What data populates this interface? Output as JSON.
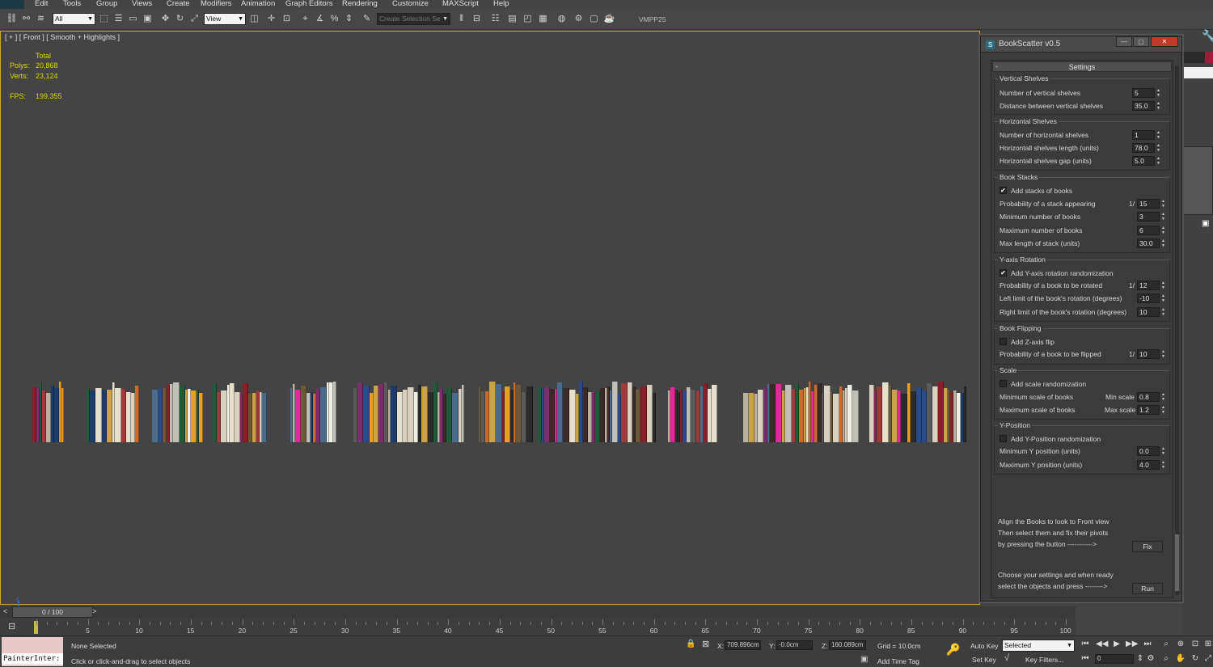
{
  "menu": [
    "Edit",
    "Tools",
    "Group",
    "Views",
    "Create",
    "Modifiers",
    "Animation",
    "Graph Editors",
    "Rendering",
    "Customize",
    "MAXScript",
    "Help"
  ],
  "toolbar": {
    "selection_filter": "All",
    "reference_coord": "View",
    "named_selection_placeholder": "Create Selection Se",
    "plugin_label": "VMPP25"
  },
  "viewport": {
    "label": "[ + ] [ Front ] [ Smooth + Highlights ]",
    "stats_header": "Total",
    "polys_label": "Polys:",
    "polys_value": "20,868",
    "verts_label": "Verts:",
    "verts_value": "23,124",
    "fps_label": "FPS:",
    "fps_value": "199.355"
  },
  "dialog": {
    "title": "BookScatter v0.5",
    "rollout_title": "Settings",
    "rollout_toggle": "-",
    "vertical": {
      "title": "Vertical Shelves",
      "num_label": "Number of vertical shelves",
      "num_value": "5",
      "dist_label": "Distance between vertical shelves",
      "dist_value": "35.0"
    },
    "horizontal": {
      "title": "Horizontal Shelves",
      "num_label": "Number of horizontal shelves",
      "num_value": "1",
      "len_label": "Horizontall shelves length (units)",
      "len_value": "78.0",
      "gap_label": "Horizontall shelves gap (units)",
      "gap_value": "5.0"
    },
    "stacks": {
      "title": "Book Stacks",
      "check_label": "Add stacks of books",
      "checked": true,
      "prob_label": "Probability of a stack appearing",
      "prob_prefix": "1/",
      "prob_value": "15",
      "min_label": "Minimum number of books",
      "min_value": "3",
      "max_label": "Maximum number of books",
      "max_value": "6",
      "len_label": "Max length of stack (units)",
      "len_value": "30.0"
    },
    "yrot": {
      "title": "Y-axis Rotation",
      "check_label": "Add Y-axis rotation randomization",
      "checked": true,
      "prob_label": "Probability of a book to be rotated",
      "prob_prefix": "1/",
      "prob_value": "12",
      "left_label": "Left limit of the book's rotation (degrees)",
      "left_value": "-10",
      "right_label": "Right limit of the book's rotation (degrees)",
      "right_value": "10"
    },
    "flip": {
      "title": "Book Flipping",
      "check_label": "Add Z-axis flip",
      "checked": false,
      "prob_label": "Probability of a book to be flipped",
      "prob_prefix": "1/",
      "prob_value": "10"
    },
    "scale": {
      "title": "Scale",
      "check_label": "Add scale randomization",
      "checked": false,
      "min_label": "Minimum scale of books",
      "min_prefix": "Min scale",
      "min_value": "0.8",
      "max_label": "Maximum scale of books",
      "max_prefix": "Max scale",
      "max_value": "1.2"
    },
    "ypos": {
      "title": "Y-Position",
      "check_label": "Add Y-Position randomization",
      "checked": false,
      "min_label": "Minimum Y position (units)",
      "min_value": "0.0",
      "max_label": "Maximum Y position (units)",
      "max_value": "4.0"
    },
    "note1": [
      "Align the Books to look to Front view",
      "Then select them and fix their pivots",
      "by pressing the button ----------->"
    ],
    "fix_button": "Fix",
    "note2": [
      "Choose your settings and when ready",
      "select the objects and press -------->"
    ],
    "run_button": "Run"
  },
  "timeline": {
    "frame_display": "0 / 100",
    "prev": "<",
    "next": ">",
    "ticks": [
      "5",
      "10",
      "15",
      "20",
      "25",
      "30",
      "35",
      "40",
      "45",
      "50",
      "55",
      "60",
      "65",
      "70",
      "75",
      "80",
      "85",
      "90",
      "95",
      "100"
    ]
  },
  "status": {
    "listener_text": "PainterInter:",
    "selection": "None Selected",
    "prompt": "Click or click-and-drag to select objects",
    "x_label": "X:",
    "x_value": "709.896cm",
    "y_label": "Y:",
    "y_value": "-0.0cm",
    "z_label": "Z:",
    "z_value": "160.089cm",
    "grid": "Grid = 10.0cm",
    "add_time_tag": "Add Time Tag",
    "auto_key": "Auto Key",
    "set_key": "Set Key",
    "key_mode": "Selected",
    "key_filters": "Key Filters...",
    "frame_value": "0"
  }
}
